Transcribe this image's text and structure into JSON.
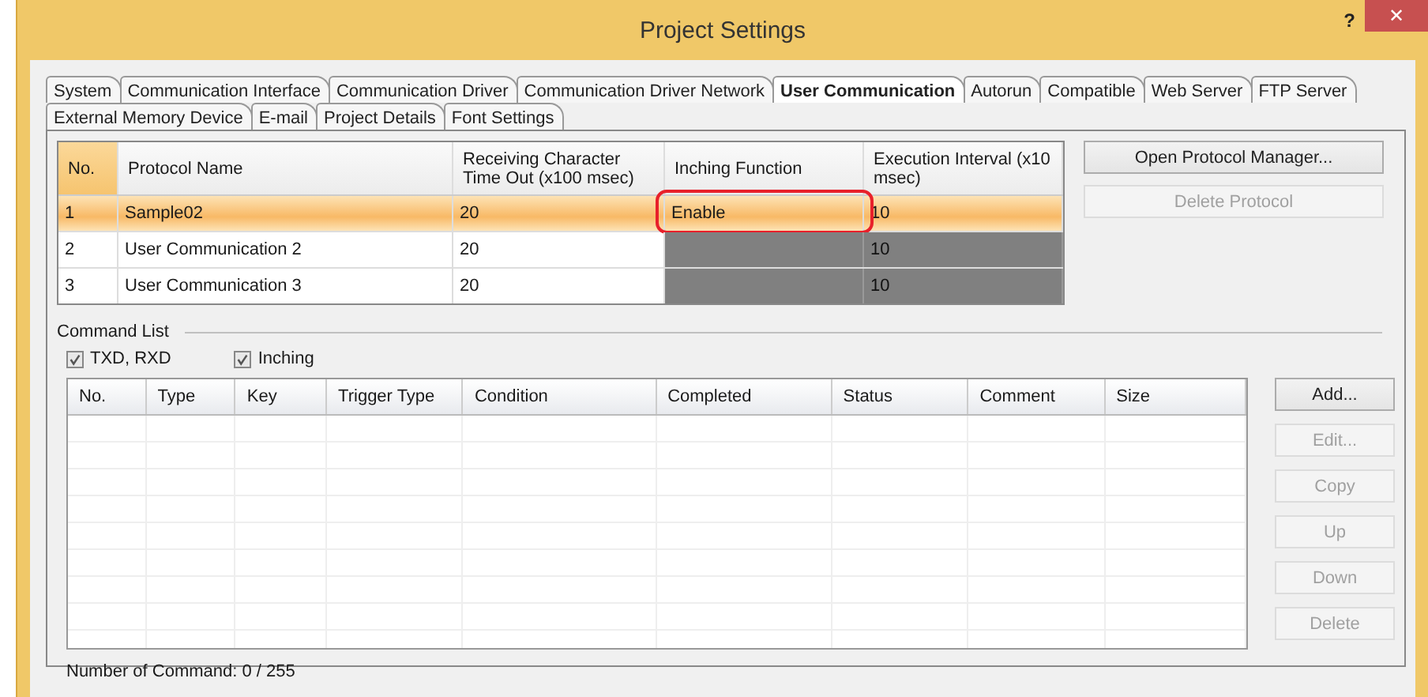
{
  "window": {
    "title": "Project Settings",
    "help": "?",
    "close": "✕"
  },
  "tab_rows": [
    [
      {
        "label": "System",
        "selected": false
      },
      {
        "label": "Communication Interface",
        "selected": false
      },
      {
        "label": "Communication Driver",
        "selected": false
      },
      {
        "label": "Communication Driver Network",
        "selected": false
      },
      {
        "label": "User Communication",
        "selected": true
      },
      {
        "label": "Autorun",
        "selected": false
      },
      {
        "label": "Compatible",
        "selected": false
      },
      {
        "label": "Web Server",
        "selected": false
      },
      {
        "label": "FTP Server",
        "selected": false
      }
    ],
    [
      {
        "label": "External Memory Device",
        "selected": false
      },
      {
        "label": "E-mail",
        "selected": false
      },
      {
        "label": "Project Details",
        "selected": false
      },
      {
        "label": "Font Settings",
        "selected": false
      }
    ]
  ],
  "protocol_table": {
    "columns": [
      "No.",
      "Protocol Name",
      "Receiving Character Time Out (x100 msec)",
      "Inching Function",
      "Execution Interval (x10 msec)"
    ],
    "rows": [
      {
        "no": "1",
        "name": "Sample02",
        "timeout": "20",
        "inching": "Enable",
        "inching_available": true,
        "interval": "10",
        "selected": true,
        "highlighted": true
      },
      {
        "no": "2",
        "name": "User Communication 2",
        "timeout": "20",
        "inching_available": false,
        "interval": "10",
        "selected": false,
        "highlighted": false
      },
      {
        "no": "3",
        "name": "User Communication 3",
        "timeout": "20",
        "inching_available": false,
        "interval": "10",
        "selected": false,
        "highlighted": false
      }
    ]
  },
  "protocol_buttons": [
    {
      "label": "Open Protocol Manager...",
      "disabled": false
    },
    {
      "label": "Delete Protocol",
      "disabled": true
    }
  ],
  "command_list": {
    "title": "Command List",
    "checkboxes": [
      {
        "label": "TXD, RXD",
        "checked": true
      },
      {
        "label": "Inching",
        "checked": true
      }
    ],
    "columns": [
      "No.",
      "Type",
      "Key",
      "Trigger Type",
      "Condition",
      "Completed",
      "Status",
      "Comment",
      "Size"
    ],
    "buttons": [
      {
        "label": "Add...",
        "disabled": false
      },
      {
        "label": "Edit...",
        "disabled": true
      },
      {
        "label": "Copy",
        "disabled": true
      },
      {
        "label": "Up",
        "disabled": true
      },
      {
        "label": "Down",
        "disabled": true
      },
      {
        "label": "Delete",
        "disabled": true
      }
    ],
    "count": "Number of Command: 0 / 255"
  }
}
